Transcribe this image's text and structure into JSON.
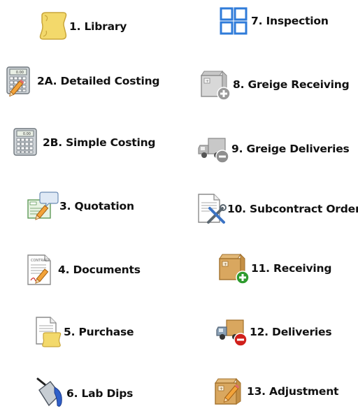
{
  "menu": {
    "left": [
      {
        "label": "1. Library",
        "icon": "scroll-icon"
      },
      {
        "label": "2A. Detailed Costing",
        "icon": "calculator-pencil-icon"
      },
      {
        "label": "2B. Simple Costing",
        "icon": "calculator-icon"
      },
      {
        "label": "3. Quotation",
        "icon": "quote-bubble-icon"
      },
      {
        "label": "4. Documents",
        "icon": "document-pencil-icon"
      },
      {
        "label": "5. Purchase",
        "icon": "document-scroll-icon"
      },
      {
        "label": "6. Lab Dips",
        "icon": "paint-bucket-icon"
      }
    ],
    "right": [
      {
        "label": "7. Inspection",
        "icon": "grid-icon"
      },
      {
        "label": "8. Greige Receiving",
        "icon": "box-add-gray-icon"
      },
      {
        "label": "9. Greige Deliveries",
        "icon": "truck-remove-gray-icon"
      },
      {
        "label": "10. Subcontract Order",
        "icon": "document-tools-icon"
      },
      {
        "label": "11. Receiving",
        "icon": "box-add-icon"
      },
      {
        "label": "12. Deliveries",
        "icon": "truck-remove-icon"
      },
      {
        "label": "13. Adjustment",
        "icon": "box-pencil-icon"
      }
    ]
  },
  "colors": {
    "scroll": "#f3d96b",
    "box": "#d9a75f",
    "grid": "#2f7bd9",
    "add": "#2e9b2e",
    "remove": "#d0201b",
    "gray": "#9a9a9a"
  }
}
